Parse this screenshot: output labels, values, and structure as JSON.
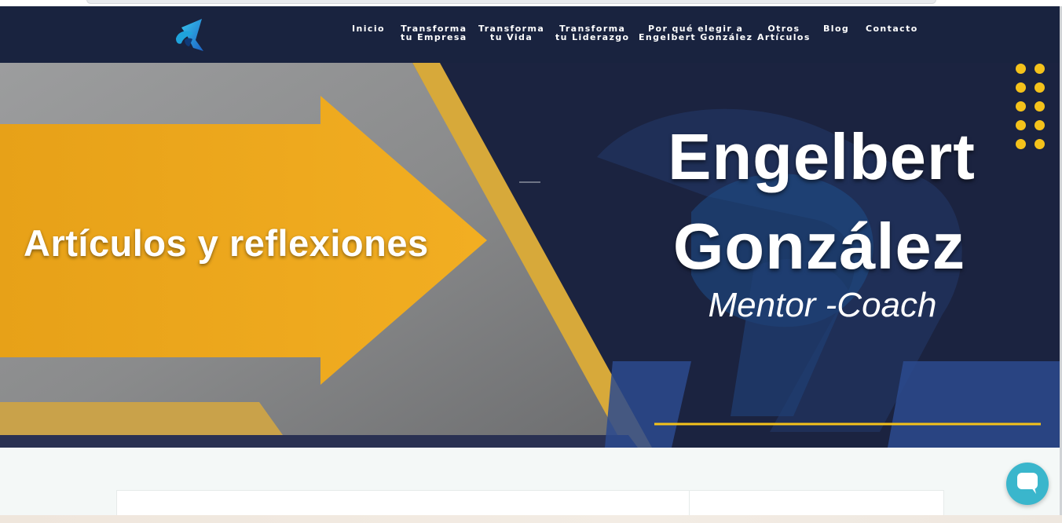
{
  "nav": {
    "items": [
      {
        "line1": "Inicio",
        "line2": ""
      },
      {
        "line1": "Transforma",
        "line2": "tu Empresa"
      },
      {
        "line1": "Transforma",
        "line2": "tu Vida"
      },
      {
        "line1": "Transforma",
        "line2": "tu Liderazgo"
      },
      {
        "line1": "Por qué elegir a",
        "line2": "Engelbert González"
      },
      {
        "line1": "Otros",
        "line2": "Artículos"
      },
      {
        "line1": "Blog",
        "line2": ""
      },
      {
        "line1": "Contacto",
        "line2": ""
      }
    ]
  },
  "hero": {
    "title": "Artículos y reflexiones",
    "name_line1": "Engelbert",
    "name_line2": "González",
    "subtitle": "Mentor -Coach"
  },
  "icons": {
    "logo": "brand-logo-icon",
    "chat": "chat-bubble-icon"
  },
  "colors": {
    "navbar": "#19233f",
    "accent_yellow": "#f4c21b",
    "arrow_orange": "#efa91c",
    "chat_button": "#3ab6cc"
  }
}
